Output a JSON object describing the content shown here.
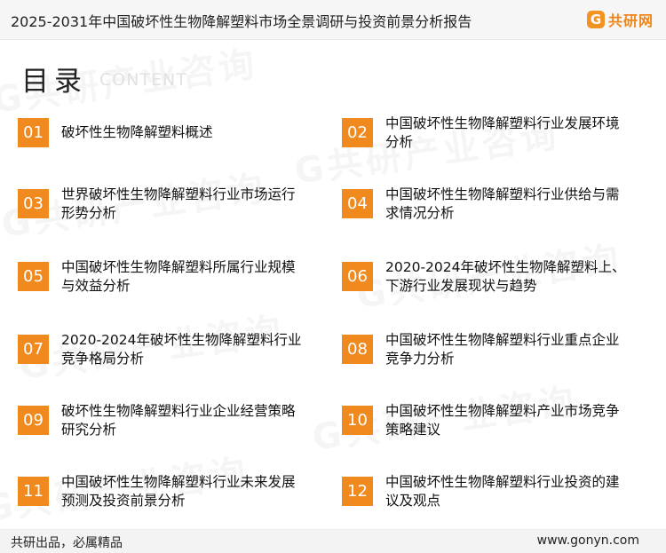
{
  "header": {
    "title": "2025-2031年中国破坏性生物降解塑料市场全景调研与投资前景分析报告",
    "logo_mark": "G",
    "logo_text": "共研网"
  },
  "section": {
    "title": "目录",
    "subtitle": "CONTENT"
  },
  "watermark_text": "G共研产业咨询",
  "toc": [
    {
      "num": "01",
      "text": "破坏性生物降解塑料概述"
    },
    {
      "num": "02",
      "text": "中国破坏性生物降解塑料行业发展环境分析"
    },
    {
      "num": "03",
      "text": "世界破坏性生物降解塑料行业市场运行形势分析"
    },
    {
      "num": "04",
      "text": "中国破坏性生物降解塑料行业供给与需求情况分析"
    },
    {
      "num": "05",
      "text": "中国破坏性生物降解塑料所属行业规模与效益分析"
    },
    {
      "num": "06",
      "text": "2020-2024年破坏性生物降解塑料上、下游行业发展现状与趋势"
    },
    {
      "num": "07",
      "text": "2020-2024年破坏性生物降解塑料行业竞争格局分析"
    },
    {
      "num": "08",
      "text": "中国破坏性生物降解塑料行业重点企业竞争力分析"
    },
    {
      "num": "09",
      "text": "破坏性生物降解塑料行业企业经营策略研究分析"
    },
    {
      "num": "10",
      "text": "中国破坏性生物降解塑料产业市场竞争策略建议"
    },
    {
      "num": "11",
      "text": "中国破坏性生物降解塑料行业未来发展预测及投资前景分析"
    },
    {
      "num": "12",
      "text": "中国破坏性生物降解塑料行业投资的建议及观点"
    }
  ],
  "footer": {
    "left": "共研出品，必属精品",
    "right": "www.gonyn.com"
  }
}
